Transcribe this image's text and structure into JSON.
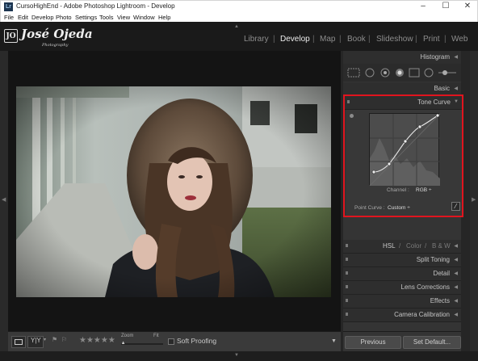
{
  "window": {
    "title": "CursoHighEnd - Adobe Photoshop Lightroom - Develop",
    "icon_text": "Lr",
    "minimize": "–",
    "maximize": "☐",
    "close": "✕"
  },
  "menubar": [
    "File",
    "Edit",
    "Develop",
    "Photo",
    "Settings",
    "Tools",
    "View",
    "Window",
    "Help"
  ],
  "identity_plate": {
    "logo_badge": "JO",
    "name": "José Ojeda",
    "subtitle": "Photography"
  },
  "modules": [
    {
      "label": "Library",
      "active": false
    },
    {
      "label": "Develop",
      "active": true
    },
    {
      "label": "Map",
      "active": false
    },
    {
      "label": "Book",
      "active": false
    },
    {
      "label": "Slideshow",
      "active": false
    },
    {
      "label": "Print",
      "active": false
    },
    {
      "label": "Web",
      "active": false
    }
  ],
  "right_panel": {
    "histogram": "Histogram",
    "basic": "Basic",
    "tone_curve": {
      "title": "Tone Curve",
      "channel_label": "Channel :",
      "channel_value": "RGB ÷",
      "point_curve_label": "Point Curve :",
      "point_curve_value": "Custom ÷"
    },
    "hsl": {
      "hsl": "HSL",
      "color": "Color",
      "bw": "B & W",
      "sep": "/"
    },
    "sections": [
      "Split Toning",
      "Detail",
      "Lens Corrections",
      "Effects",
      "Camera Calibration"
    ]
  },
  "toolbar": {
    "stars": "★★★★★",
    "zoom_label": "Zoom",
    "fit_label": "Fit",
    "zoom_value": 0.05,
    "soft_proofing": "Soft Proofing"
  },
  "footer": {
    "previous": "Previous",
    "set_default": "Set Default..."
  },
  "colors": {
    "highlight_border": "#e0141e",
    "panel_bg": "#343434",
    "active_module": "#ececec"
  },
  "icons": [
    "minimize-icon",
    "maximize-icon",
    "close-icon",
    "target-adjust-icon",
    "point-curve-edit-icon",
    "panel-collapse-icon"
  ]
}
